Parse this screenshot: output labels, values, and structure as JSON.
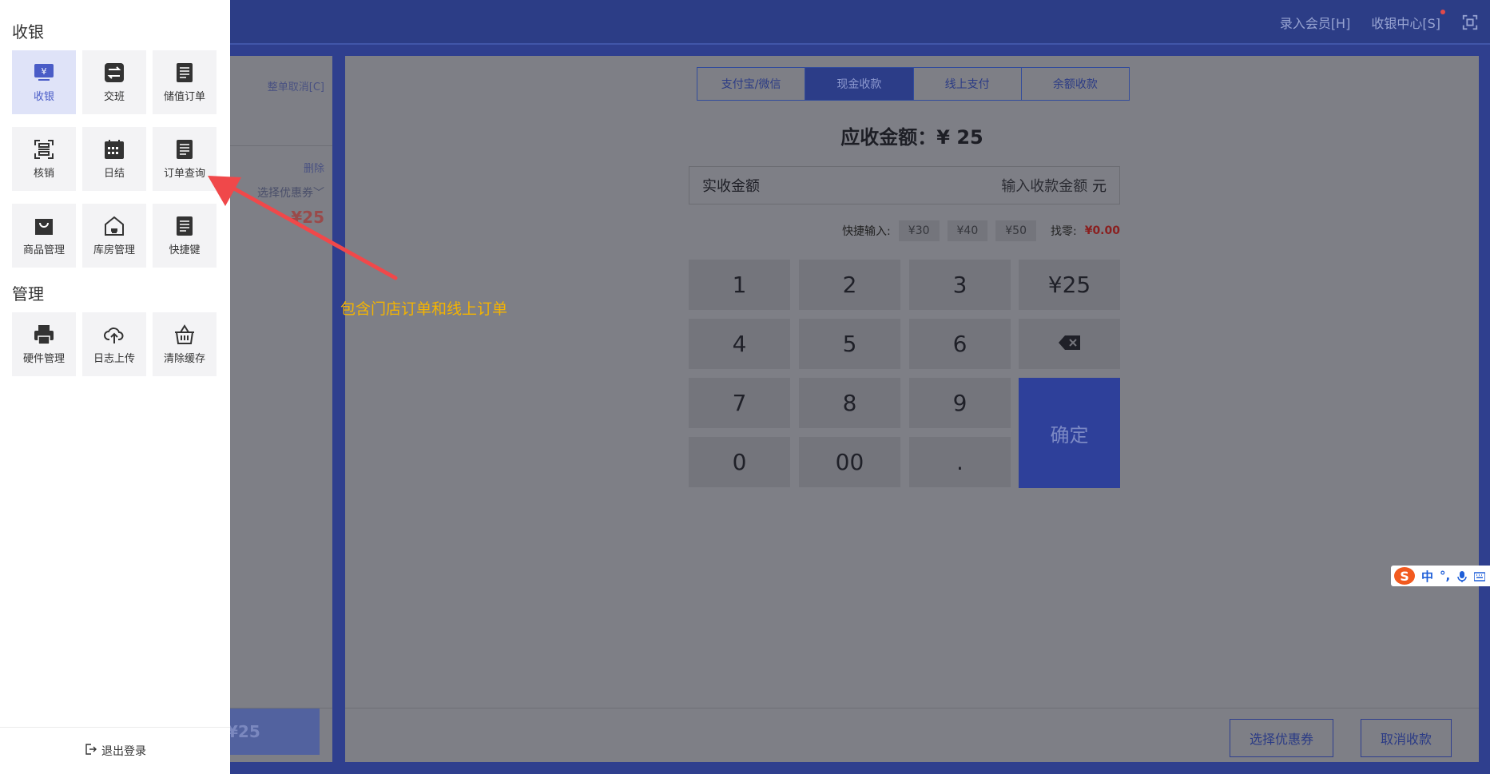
{
  "topbar": {
    "member_link": "录入会员[H]",
    "cashier_center_link": "收银中心[S]"
  },
  "left_panel": {
    "cancel_all": "整单取消[C]",
    "delete": "删除",
    "coupon": "选择优惠券",
    "price": "¥25",
    "pay_button": "¥25"
  },
  "payment": {
    "tabs": [
      {
        "label": "支付宝/微信",
        "active": false
      },
      {
        "label": "现金收款",
        "active": true
      },
      {
        "label": "线上支付",
        "active": false
      },
      {
        "label": "余额收款",
        "active": false
      }
    ],
    "amount_due": "应收金额：¥ 25",
    "received_label": "实收金额",
    "received_placeholder": "输入收款金额",
    "received_unit": "元",
    "quick_input_label": "快捷输入:",
    "quick_amounts": [
      "¥30",
      "¥40",
      "¥50"
    ],
    "change_label": "找零:",
    "change_value": "¥0.00",
    "keys": [
      "1",
      "2",
      "3",
      "¥25",
      "4",
      "5",
      "6",
      "7",
      "8",
      "9",
      "0",
      "00",
      "."
    ],
    "backspace_icon": "backspace-icon",
    "confirm": "确定",
    "select_coupon_button": "选择优惠券",
    "cancel_payment_button": "取消收款"
  },
  "side_menu": {
    "section_cashier": "收银",
    "cashier_items": [
      {
        "label": "收银",
        "icon": "cashier-monitor-icon",
        "active": true
      },
      {
        "label": "交班",
        "icon": "shift-swap-icon",
        "active": false
      },
      {
        "label": "储值订单",
        "icon": "list-icon",
        "active": false
      },
      {
        "label": "核销",
        "icon": "scan-icon",
        "active": false
      },
      {
        "label": "日结",
        "icon": "calendar-icon",
        "active": false
      },
      {
        "label": "订单查询",
        "icon": "list-icon",
        "active": false
      },
      {
        "label": "商品管理",
        "icon": "bag-icon",
        "active": false
      },
      {
        "label": "库房管理",
        "icon": "warehouse-icon",
        "active": false
      },
      {
        "label": "快捷键",
        "icon": "list-icon",
        "active": false
      }
    ],
    "section_manage": "管理",
    "manage_items": [
      {
        "label": "硬件管理",
        "icon": "printer-icon",
        "active": false
      },
      {
        "label": "日志上传",
        "icon": "cloud-upload-icon",
        "active": false
      },
      {
        "label": "清除缓存",
        "icon": "basket-icon",
        "active": false
      }
    ],
    "logout": "退出登录"
  },
  "annotation": {
    "text": "包含门店订单和线上订单",
    "color": "#f5b400",
    "arrow_color": "#f0484a"
  },
  "ime": {
    "mode": "中",
    "punct": "°,"
  },
  "colors": {
    "topbar": "#2c3d86",
    "accent": "#4a5cc7",
    "confirm": "#2e409a"
  }
}
